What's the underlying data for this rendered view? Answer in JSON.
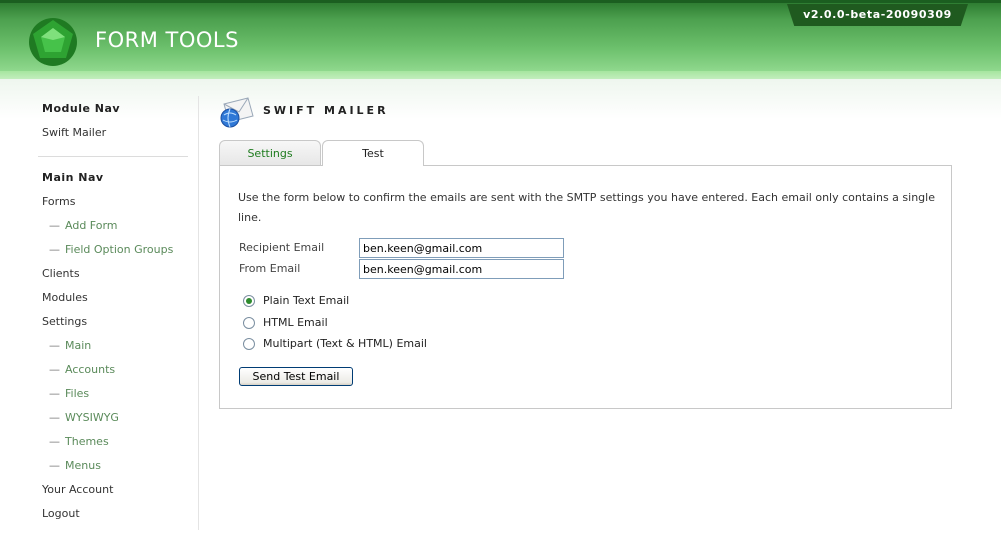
{
  "header": {
    "brand": "FORM TOOLS",
    "version": "v2.0.0-beta-20090309",
    "logo_icon": "green-pentagon-logo",
    "accent_color": "#4ca04e"
  },
  "sidebar": {
    "module_nav_heading": "Module Nav",
    "module_items": [
      {
        "label": "Swift Mailer"
      }
    ],
    "main_nav_heading": "Main Nav",
    "main_items": [
      {
        "label": "Forms",
        "sub": false
      },
      {
        "label": "Add Form",
        "sub": true
      },
      {
        "label": "Field Option Groups",
        "sub": true
      },
      {
        "label": "Clients",
        "sub": false
      },
      {
        "label": "Modules",
        "sub": false
      },
      {
        "label": "Settings",
        "sub": false
      },
      {
        "label": "Main",
        "sub": true
      },
      {
        "label": "Accounts",
        "sub": true
      },
      {
        "label": "Files",
        "sub": true
      },
      {
        "label": "WYSIWYG",
        "sub": true
      },
      {
        "label": "Themes",
        "sub": true
      },
      {
        "label": "Menus",
        "sub": true
      },
      {
        "label": "Your Account",
        "sub": false
      },
      {
        "label": "Logout",
        "sub": false
      }
    ],
    "sub_dash": "—"
  },
  "main": {
    "title": "SWIFT MAILER",
    "title_icon": "mail-envelope-globe-icon",
    "tabs": [
      {
        "label": "Settings",
        "active": false
      },
      {
        "label": "Test",
        "active": true
      }
    ],
    "intro": "Use the form below to confirm the emails are sent with the SMTP settings you have entered. Each email only contains a single line.",
    "fields": {
      "recipient_label": "Recipient Email",
      "recipient_value": "ben.keen@gmail.com",
      "from_label": "From Email",
      "from_value": "ben.keen@gmail.com"
    },
    "email_types": [
      {
        "label": "Plain Text Email",
        "checked": true
      },
      {
        "label": "HTML Email",
        "checked": false
      },
      {
        "label": "Multipart (Text & HTML) Email",
        "checked": false
      }
    ],
    "submit_label": "Send Test Email"
  }
}
